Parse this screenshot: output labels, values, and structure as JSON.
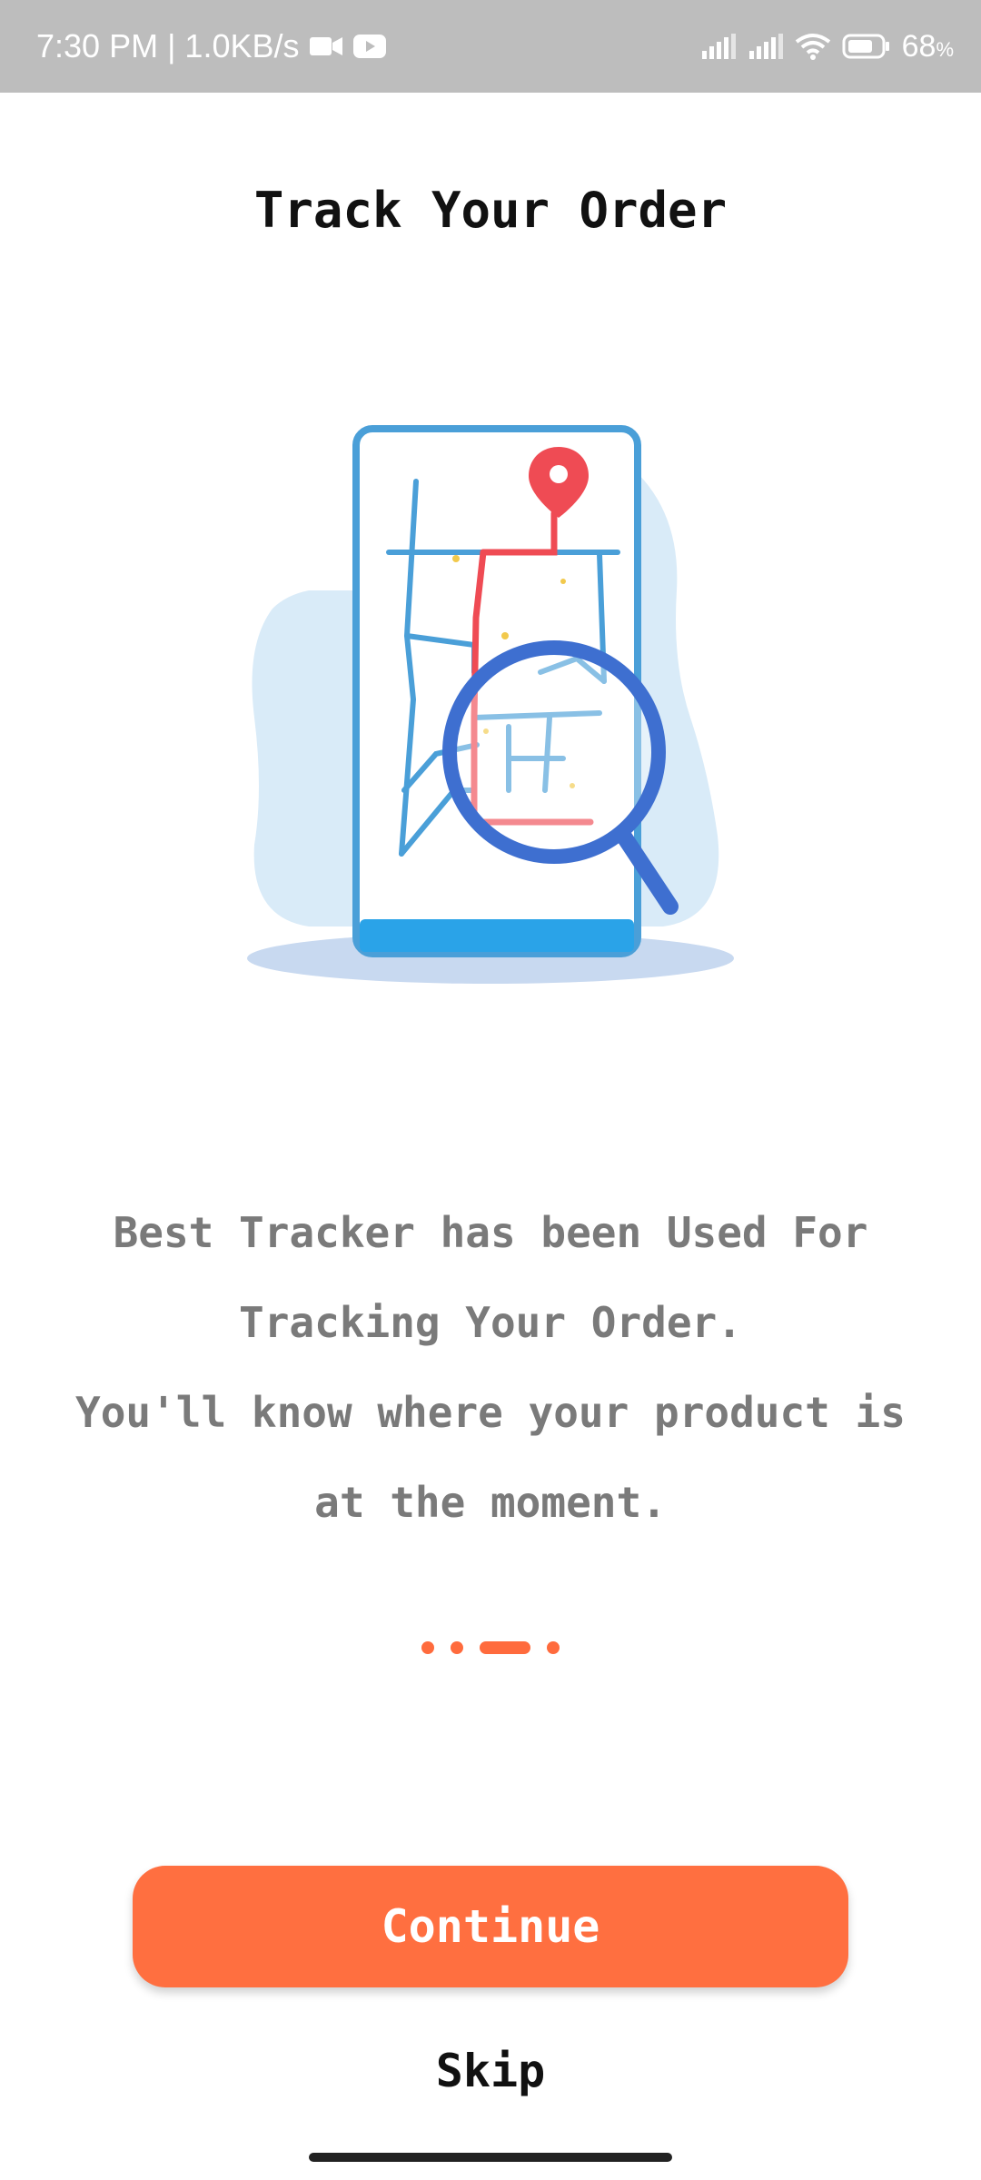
{
  "status_bar": {
    "time_speed": "7:30 PM | 1.0KB/s",
    "battery": "68",
    "battery_unit": "%",
    "icons": [
      "video-camera-icon",
      "youtube-icon",
      "signal-icon",
      "signal-icon",
      "wifi-icon",
      "battery-icon"
    ]
  },
  "onboarding": {
    "title": "Track Your Order",
    "illustration": "map-tracking-illustration",
    "description_lines": [
      "Best Tracker has been Used For",
      "Tracking Your Order.",
      "You'll know where your product is",
      "at the moment."
    ],
    "pager": {
      "total": 4,
      "active_index": 2
    },
    "continue_label": "Continue",
    "skip_label": "Skip"
  },
  "colors": {
    "accent": "#ff6f40",
    "status_bar_bg": "#bdbdbd",
    "map_blue": "#4a9fd8",
    "route_red": "#ef4b54",
    "magnifier_blue": "#3e6fd0"
  }
}
